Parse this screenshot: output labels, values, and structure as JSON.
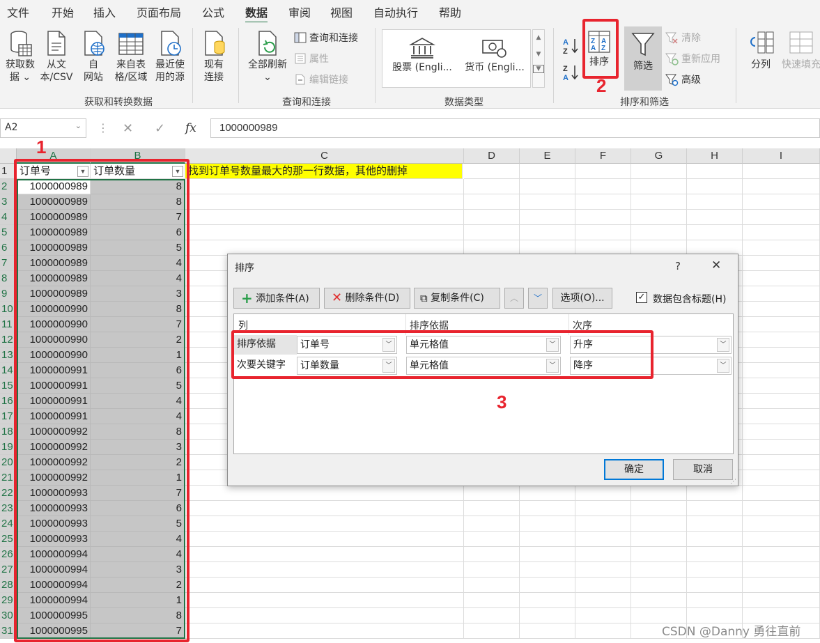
{
  "tabs": [
    "文件",
    "开始",
    "插入",
    "页面布局",
    "公式",
    "数据",
    "审阅",
    "视图",
    "自动执行",
    "帮助"
  ],
  "active_tab": "数据",
  "ribbon": {
    "get_data": {
      "line1": "获取数",
      "line2": "据 ⌄"
    },
    "from_text": {
      "line1": "从文",
      "line2": "本/CSV"
    },
    "from_web": {
      "line1": "自",
      "line2": "网站"
    },
    "from_table": {
      "line1": "来自表",
      "line2": "格/区域"
    },
    "recent_sources": {
      "line1": "最近使",
      "line2": "用的源"
    },
    "existing_conn": {
      "line1": "现有",
      "line2": "连接"
    },
    "group_get_transform": "获取和转换数据",
    "refresh_all": {
      "line1": "全部刷新",
      "line2": "⌄"
    },
    "queries_connections": "查询和连接",
    "properties": "属性",
    "edit_links": "编辑链接",
    "group_queries": "查询和连接",
    "stocks": "股票 (Engli...",
    "currency": "货币 (Engli...",
    "group_data_types": "数据类型",
    "sort": "排序",
    "filter": "筛选",
    "clear": "清除",
    "reapply": "重新应用",
    "advanced": "高级",
    "group_sort_filter": "排序和筛选",
    "text_to_columns": "分列",
    "flash_fill": "快速填充"
  },
  "formula_bar": {
    "name_box": "A2",
    "fx": "fx",
    "value": "1000000989"
  },
  "columns": [
    "A",
    "B",
    "C",
    "D",
    "E",
    "F",
    "G",
    "H",
    "I"
  ],
  "sheet": {
    "header_a": "订单号",
    "header_b": "订单数量",
    "note": "找到订单号数量最大的那一行数据，其他的删掉",
    "rows": [
      [
        "1000000989",
        "8"
      ],
      [
        "1000000989",
        "8"
      ],
      [
        "1000000989",
        "7"
      ],
      [
        "1000000989",
        "6"
      ],
      [
        "1000000989",
        "5"
      ],
      [
        "1000000989",
        "4"
      ],
      [
        "1000000989",
        "4"
      ],
      [
        "1000000989",
        "3"
      ],
      [
        "1000000990",
        "8"
      ],
      [
        "1000000990",
        "7"
      ],
      [
        "1000000990",
        "2"
      ],
      [
        "1000000990",
        "1"
      ],
      [
        "1000000991",
        "6"
      ],
      [
        "1000000991",
        "5"
      ],
      [
        "1000000991",
        "4"
      ],
      [
        "1000000991",
        "4"
      ],
      [
        "1000000992",
        "8"
      ],
      [
        "1000000992",
        "3"
      ],
      [
        "1000000992",
        "2"
      ],
      [
        "1000000992",
        "1"
      ],
      [
        "1000000993",
        "7"
      ],
      [
        "1000000993",
        "6"
      ],
      [
        "1000000993",
        "5"
      ],
      [
        "1000000993",
        "4"
      ],
      [
        "1000000994",
        "4"
      ],
      [
        "1000000994",
        "3"
      ],
      [
        "1000000994",
        "2"
      ],
      [
        "1000000994",
        "1"
      ],
      [
        "1000000995",
        "8"
      ],
      [
        "1000000995",
        "7"
      ]
    ]
  },
  "dialog": {
    "title": "排序",
    "help": "?",
    "close": "✕",
    "add_level": "添加条件(A)",
    "delete_level": "删除条件(D)",
    "copy_level": "复制条件(C)",
    "options": "选项(O)...",
    "has_headers": "数据包含标题(H)",
    "has_headers_checked": true,
    "col_header_column": "列",
    "col_header_sort_on": "排序依据",
    "col_header_order": "次序",
    "levels": [
      {
        "label": "排序依据",
        "column": "订单号",
        "sort_on": "单元格值",
        "order": "升序"
      },
      {
        "label": "次要关键字",
        "column": "订单数量",
        "sort_on": "单元格值",
        "order": "降序"
      }
    ],
    "ok": "确定",
    "cancel": "取消"
  },
  "annotations": [
    "1",
    "2",
    "3"
  ],
  "watermark": "CSDN @Danny 勇往直前",
  "colors": {
    "accent": "#217346",
    "annotation": "#e8242e",
    "note_bg": "#ffff00",
    "selection": "#c6c6c6",
    "dialog_primary": "#0078d7"
  }
}
